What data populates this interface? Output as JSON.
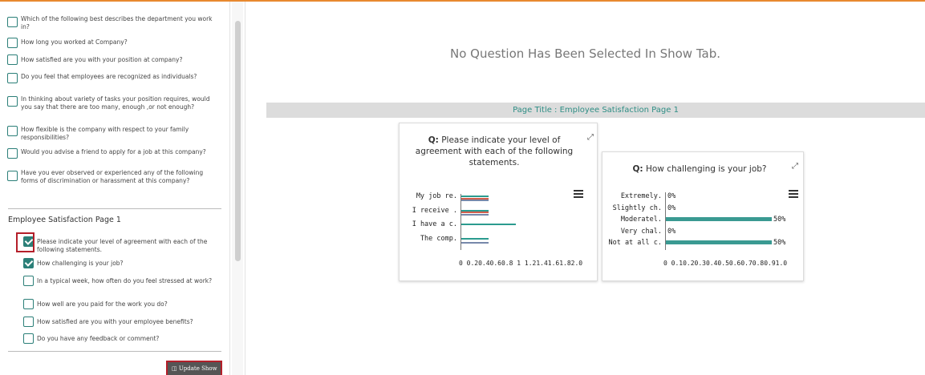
{
  "sidebar": {
    "questions": [
      {
        "text": "Which of the following best describes the department you work in?",
        "checked": false
      },
      {
        "text": "How long you worked at Company?",
        "checked": false
      },
      {
        "text": "How satisfied are you with your position at company?",
        "checked": false
      },
      {
        "text": "Do you feel that employees are recognized as individuals?",
        "checked": false
      },
      {
        "text": "In thinking about variety of tasks your position requires, would you say that there are too many, enough ,or not enough?",
        "checked": false
      },
      {
        "text": "How flexible is the company with respect to your family responsibilities?",
        "checked": false
      },
      {
        "text": "Would you advise a friend to apply for a job at this company?",
        "checked": false
      },
      {
        "text": "Have you ever observed or experienced any of the following forms of discrimination or harassment at this company?",
        "checked": false
      }
    ],
    "group_title": "Employee Satisfaction Page 1",
    "group_questions": [
      {
        "text": "Please indicate your level of agreement with each of the following statements.",
        "checked": true
      },
      {
        "text": "How challenging is your job?",
        "checked": true
      },
      {
        "text": "In a typical week, how often do you feel stressed at work?",
        "checked": false
      },
      {
        "text": "How well are you paid for the work you do?",
        "checked": false
      },
      {
        "text": "How satisfied are you with your employee benefits?",
        "checked": false
      },
      {
        "text": "Do you have any feedback or comment?",
        "checked": false
      }
    ],
    "update_button": "Update Show"
  },
  "main": {
    "no_question_text": "No Question Has Been Selected In Show Tab.",
    "page_title": "Page Title : Employee Satisfaction Page 1",
    "q_prefix": "Q:",
    "cards": [
      {
        "question": "Please indicate your level of agreement with each of the following statements."
      },
      {
        "question": "How challenging is your job?"
      }
    ]
  },
  "chart_data": [
    {
      "type": "bar",
      "orientation": "horizontal",
      "categories": [
        "My job re.",
        "I receive .",
        "I have a c.",
        "The comp."
      ],
      "series": [
        {
          "color": "#2b9b8f",
          "values": [
            0.5,
            0.5,
            1.0,
            0.5
          ]
        },
        {
          "color": "#d35f4d",
          "values": [
            0.5,
            0.5,
            0.0,
            0.0
          ]
        },
        {
          "color": "#7788aa",
          "values": [
            0.5,
            0.5,
            0.0,
            0.5
          ]
        }
      ],
      "x_tick_text": "0 0.20.40.60.8 1 1.21.41.61.82.0",
      "xlim": [
        0,
        2.0
      ]
    },
    {
      "type": "bar",
      "orientation": "horizontal",
      "categories": [
        "Extremely.",
        "Slightly ch.",
        "Moderatel.",
        "Very chal.",
        "Not at all c."
      ],
      "values": [
        0,
        0,
        0.5,
        0,
        0.5
      ],
      "value_labels": [
        "0%",
        "0%",
        "50%",
        "0%",
        "50%"
      ],
      "color": "#3a9a92",
      "x_tick_text": "0 0.10.20.30.40.50.60.70.80.91.0",
      "xlim": [
        0,
        1.0
      ]
    }
  ]
}
